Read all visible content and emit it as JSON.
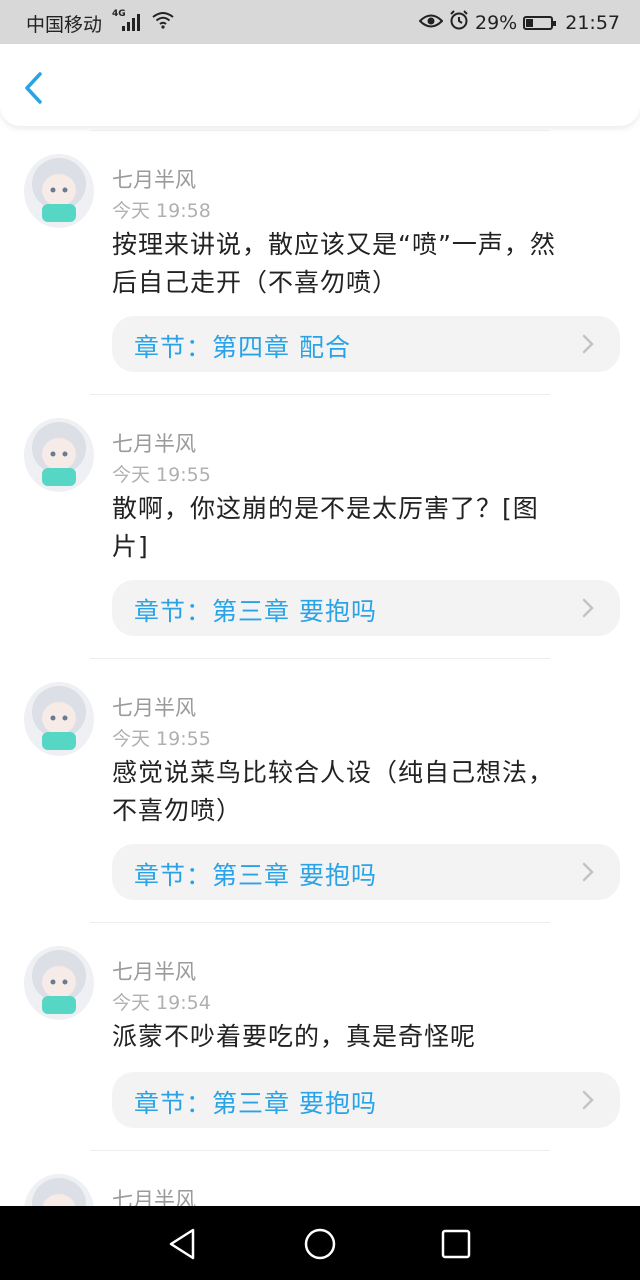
{
  "status_bar": {
    "carrier": "中国移动",
    "network_type": "4G",
    "battery": "29%",
    "time": "21:57"
  },
  "nav": {
    "back_icon": "chevron-left-icon"
  },
  "accent_color": "#2aa3e6",
  "comments": [
    {
      "author": "七月半风",
      "time": "今天 19:58",
      "lines": [
        "按理来讲说，散应该又是“喷”一声，然",
        "后自己走开（不喜勿喷）"
      ],
      "chapter": "章节：第四章 配合"
    },
    {
      "author": "七月半风",
      "time": "今天 19:55",
      "lines": [
        "散啊，你这崩的是不是太厉害了？[图",
        "片]"
      ],
      "chapter": "章节：第三章 要抱吗"
    },
    {
      "author": "七月半风",
      "time": "今天 19:55",
      "lines": [
        "感觉说菜鸟比较合人设（纯自己想法，",
        "不喜勿喷）"
      ],
      "chapter": "章节：第三章 要抱吗"
    },
    {
      "author": "七月半风",
      "time": "今天 19:54",
      "lines": [
        "派蒙不吵着要吃的，真是奇怪呢"
      ],
      "chapter": "章节：第三章 要抱吗"
    },
    {
      "author": "七月半风"
    }
  ]
}
